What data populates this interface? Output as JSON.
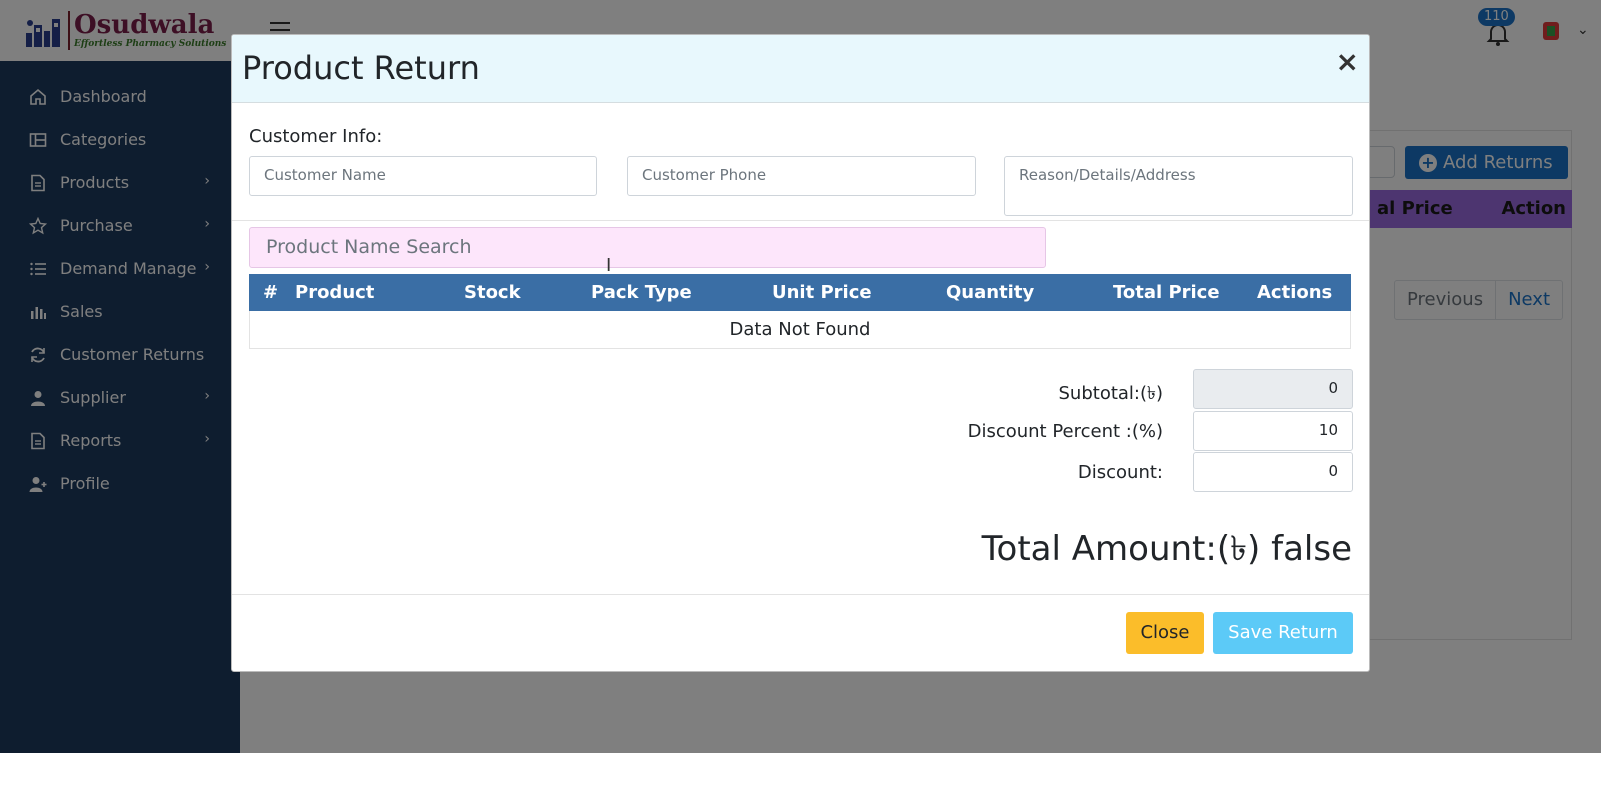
{
  "brand": {
    "name": "Osudwala",
    "tagline": "Effortless Pharmacy Solutions"
  },
  "topbar": {
    "notification_count": "110"
  },
  "sidebar": {
    "items": [
      {
        "label": "Dashboard",
        "icon": "home-icon",
        "has_submenu": false
      },
      {
        "label": "Categories",
        "icon": "categories-icon",
        "has_submenu": false
      },
      {
        "label": "Products",
        "icon": "document-icon",
        "has_submenu": true
      },
      {
        "label": "Purchase",
        "icon": "star-icon",
        "has_submenu": true
      },
      {
        "label": "Demand Manage",
        "icon": "list-icon",
        "has_submenu": true
      },
      {
        "label": "Sales",
        "icon": "bar-chart-icon",
        "has_submenu": false
      },
      {
        "label": "Customer Returns",
        "icon": "refresh-icon",
        "has_submenu": false
      },
      {
        "label": "Supplier",
        "icon": "user-icon",
        "has_submenu": true
      },
      {
        "label": "Reports",
        "icon": "report-icon",
        "has_submenu": true
      },
      {
        "label": "Profile",
        "icon": "user-add-icon",
        "has_submenu": false
      }
    ]
  },
  "background_page": {
    "add_button_label": "Add Returns",
    "table_headers": [
      "al Price",
      "Action"
    ],
    "pagination": {
      "previous": "Previous",
      "next": "Next"
    }
  },
  "modal": {
    "title": "Product Return",
    "close_symbol": "×",
    "customer_info_label": "Customer Info:",
    "customer_name_placeholder": "Customer Name",
    "customer_phone_placeholder": "Customer Phone",
    "reason_placeholder": "Reason/Details/Address",
    "product_search_placeholder": "Product Name Search",
    "table": {
      "headers": [
        "#",
        "Product",
        "Stock",
        "Pack Type",
        "Unit Price",
        "Quantity",
        "Total Price",
        "Actions"
      ],
      "empty_message": "Data Not Found"
    },
    "summary": {
      "subtotal_label": "Subtotal:(৳)",
      "subtotal_value": "0",
      "discount_percent_label": "Discount Percent :(%)",
      "discount_percent_value": "10",
      "discount_label": "Discount:",
      "discount_value": "0",
      "total_label": "Total Amount:(৳) false"
    },
    "buttons": {
      "close": "Close",
      "save": "Save Return"
    }
  },
  "colors": {
    "sidebar": "#1c3a5e",
    "table_header": "#3a6ea5",
    "search_bg": "#fde6fb",
    "close_button": "#fbbd2a",
    "save_button": "#5ccaf7",
    "accent": "#1a73c8"
  }
}
